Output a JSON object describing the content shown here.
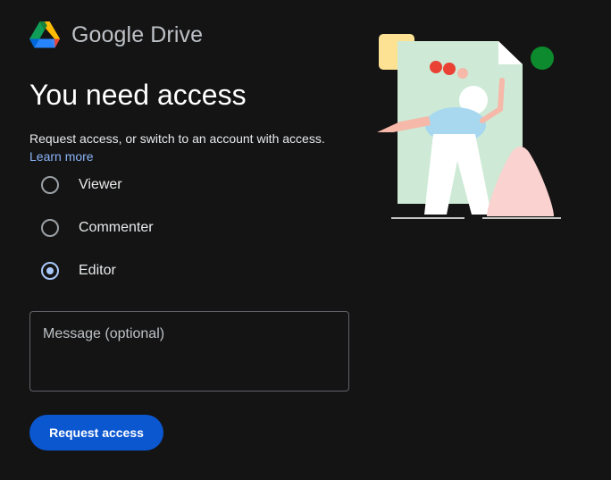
{
  "header": {
    "brand": "Google Drive",
    "logo_icon": "google-drive-logo"
  },
  "main": {
    "title": "You need access",
    "subtitle": "Request access, or switch to an account with access.",
    "learn_more": "Learn more",
    "roles": [
      {
        "label": "Viewer",
        "checked": false
      },
      {
        "label": "Commenter",
        "checked": false
      },
      {
        "label": "Editor",
        "checked": true
      }
    ],
    "message": {
      "placeholder": "Message (optional)",
      "value": ""
    },
    "request_button": "Request access"
  },
  "colors": {
    "background": "#141414",
    "accent": "#a8c7fa",
    "link": "#8ab4f8",
    "button": "#0b57d0"
  }
}
